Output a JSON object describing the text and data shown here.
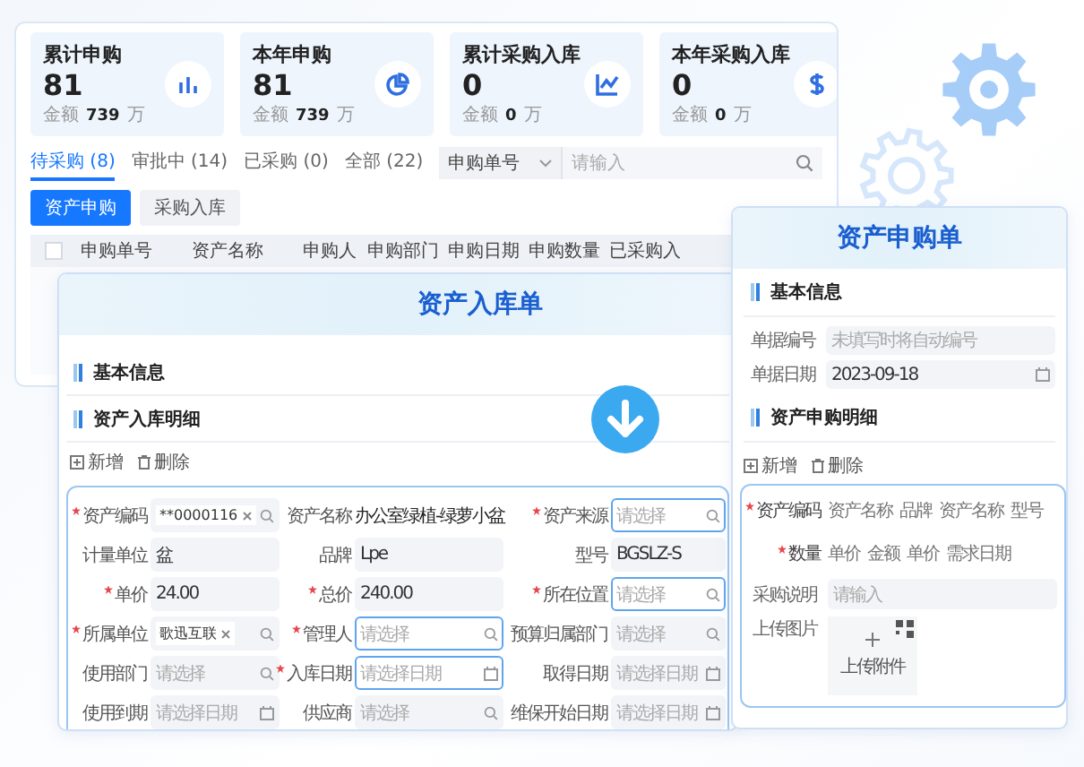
{
  "summary_cards": [
    {
      "title": "累计申购",
      "count": "81",
      "amount_label": "金额",
      "amount": "739",
      "unit": "万"
    },
    {
      "title": "本年申购",
      "count": "81",
      "amount_label": "金额",
      "amount": "739",
      "unit": "万"
    },
    {
      "title": "累计采购入库",
      "count": "0",
      "amount_label": "金额",
      "amount": "0",
      "unit": "万"
    },
    {
      "title": "本年采购入库",
      "count": "0",
      "amount_label": "金额",
      "amount": "0",
      "unit": "万"
    }
  ],
  "tabs": [
    {
      "label": "待采购 (8)",
      "selected": true
    },
    {
      "label": "审批中 (14)",
      "selected": false
    },
    {
      "label": "已采购 (0)",
      "selected": false
    },
    {
      "label": "全部 (22)",
      "selected": false
    }
  ],
  "search": {
    "field": "申购单号",
    "placeholder": "请输入"
  },
  "action_buttons": [
    {
      "label": "资产申购",
      "primary": true
    },
    {
      "label": "采购入库",
      "primary": false
    }
  ],
  "table": {
    "header_checked": false,
    "columns": [
      "申购单号",
      "资产名称",
      "申购人",
      "申购部门",
      "申购日期",
      "申购数量",
      "已采购入"
    ]
  },
  "receipt_form": {
    "title": "资产入库单",
    "basic_section": "基本信息",
    "detail_section": "资产入库明细",
    "toolbar": [
      "新增",
      "删除"
    ],
    "fields": [
      {
        "label": "资产编码",
        "required": true,
        "kind": "tag",
        "value": "**0000116",
        "focused": false
      },
      {
        "label": "资产名称",
        "required": false,
        "kind": "text",
        "value": "办公室绿植-绿萝小盆",
        "focused": false
      },
      {
        "label": "资产来源",
        "required": true,
        "kind": "select",
        "placeholder": "请选择",
        "focused": true
      },
      {
        "label": "计量单位",
        "required": false,
        "kind": "input",
        "value": "盆",
        "focused": false
      },
      {
        "label": "品牌",
        "required": false,
        "kind": "input",
        "value": "Lpe",
        "focused": false
      },
      {
        "label": "型号",
        "required": false,
        "kind": "input",
        "value": "BGSLZ-S",
        "focused": false
      },
      {
        "label": "单价",
        "required": true,
        "kind": "input",
        "value": "24.00",
        "focused": false
      },
      {
        "label": "总价",
        "required": true,
        "kind": "input",
        "value": "240.00",
        "focused": false
      },
      {
        "label": "所在位置",
        "required": true,
        "kind": "select",
        "placeholder": "请选择",
        "focused": true
      },
      {
        "label": "所属单位",
        "required": true,
        "kind": "tag",
        "value": "歌迅互联",
        "focused": false
      },
      {
        "label": "管理人",
        "required": true,
        "kind": "select",
        "placeholder": "请选择",
        "focused": true
      },
      {
        "label": "预算归属部门",
        "required": false,
        "kind": "select",
        "placeholder": "请选择",
        "focused": false
      },
      {
        "label": "使用部门",
        "required": false,
        "kind": "select",
        "placeholder": "请选择",
        "focused": false
      },
      {
        "label": "入库日期",
        "required": true,
        "kind": "date",
        "placeholder": "请选择日期",
        "focused": true
      },
      {
        "label": "取得日期",
        "required": false,
        "kind": "date",
        "placeholder": "请选择日期",
        "focused": false
      },
      {
        "label": "使用到期",
        "required": false,
        "kind": "date",
        "placeholder": "请选择日期",
        "focused": false
      },
      {
        "label": "供应商",
        "required": false,
        "kind": "select",
        "placeholder": "请选择",
        "focused": false
      },
      {
        "label": "维保开始日期",
        "required": false,
        "kind": "date",
        "placeholder": "请选择日期",
        "focused": false
      }
    ]
  },
  "request_form": {
    "title": "资产申购单",
    "basic_section": "基本信息",
    "fields": [
      {
        "label": "单据编号",
        "kind": "input",
        "placeholder": "未填写时将自动编号"
      },
      {
        "label": "单据日期",
        "kind": "date",
        "value": "2023-09-18"
      }
    ],
    "detail_section": "资产申购明细",
    "toolbar": [
      "新增",
      "删除"
    ],
    "detail_rows": [
      {
        "label": "资产编码",
        "required": true,
        "cells": [
          "资产名称",
          "品牌",
          "资产名称",
          "型号"
        ]
      },
      {
        "label": "数量",
        "required": true,
        "cells": [
          "单价",
          "金额",
          "单价",
          "需求日期"
        ]
      }
    ],
    "note": {
      "label": "采购说明",
      "placeholder": "请输入"
    },
    "upload": {
      "label": "上传图片",
      "button": "上传附件"
    }
  }
}
